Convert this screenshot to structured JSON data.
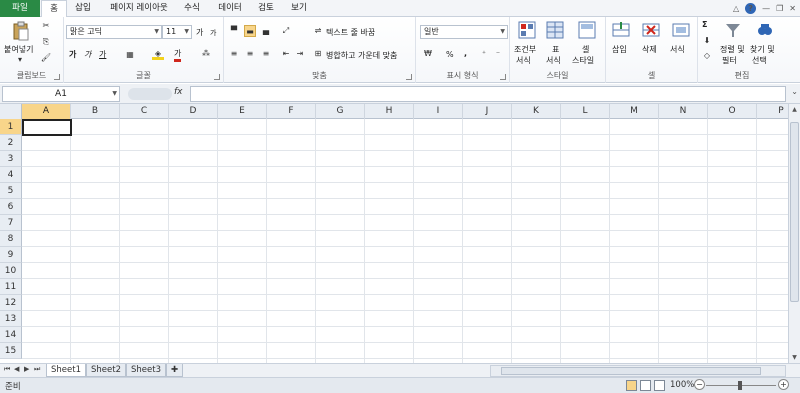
{
  "tabs": [
    "파일",
    "홈",
    "삽입",
    "페이지 레이아웃",
    "수식",
    "데이터",
    "검토",
    "보기"
  ],
  "clipboard": {
    "paste": "붙여넣기",
    "label": "클립보드"
  },
  "font": {
    "name": "맑은 고딕",
    "size": "11",
    "grow": "가",
    "shrink": "가",
    "bold": "가",
    "italic": "가",
    "underline": "가",
    "font_color": "가",
    "fill_color": "가",
    "label": "글꼴"
  },
  "alignment": {
    "wrap_text": "텍스트 줄 바꿈",
    "merge_center": "병합하고 가운데 맞춤",
    "label": "맞춤"
  },
  "number": {
    "format": "일반",
    "percent": "%",
    "comma": ",",
    "label": "표시 형식"
  },
  "styles": {
    "conditional": "조건부",
    "conditional2": "서식",
    "table": "표",
    "table2": "서식",
    "cell_styles": "셀",
    "cell_styles2": "스타일",
    "label": "스타일"
  },
  "cells": {
    "insert": "삽입",
    "delete": "삭제",
    "format": "서식",
    "label": "셀"
  },
  "editing": {
    "sigma": "Σ",
    "sort_filter": "정렬 및",
    "sort_filter2": "필터",
    "find_select": "찾기 및",
    "find_select2": "선택",
    "label": "편집"
  },
  "formula_bar": {
    "name_box": "A1",
    "fx": "fx"
  },
  "columns": [
    "A",
    "B",
    "C",
    "D",
    "E",
    "F",
    "G",
    "H",
    "I",
    "J",
    "K",
    "L",
    "M",
    "N",
    "O",
    "P"
  ],
  "rows": [
    "1",
    "2",
    "3",
    "4",
    "5",
    "6",
    "7",
    "8",
    "9",
    "10",
    "11",
    "12",
    "13",
    "14",
    "15"
  ],
  "sheets": [
    "Sheet1",
    "Sheet2",
    "Sheet3"
  ],
  "status": {
    "ready": "준비",
    "zoom": "100%",
    "zoom_minus": "−",
    "zoom_plus": "+"
  }
}
